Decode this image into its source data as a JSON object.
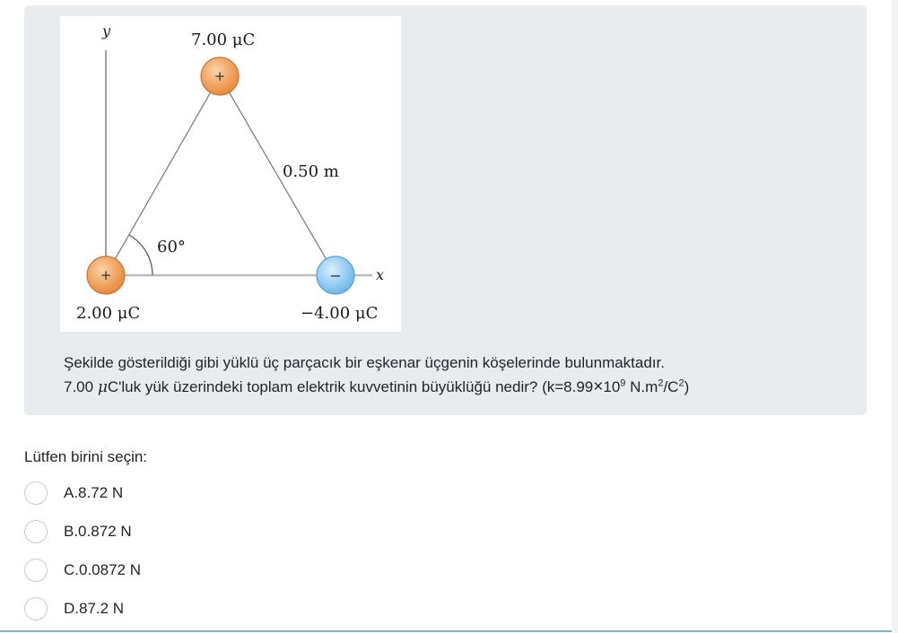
{
  "figure": {
    "axis_y": "y",
    "axis_x": "x",
    "charge_top": "7.00 μC",
    "charge_left": "2.00 μC",
    "charge_right": "−4.00 μC",
    "side_length": "0.50 m",
    "angle": "60°",
    "sign_positive": "+",
    "sign_negative": "−",
    "colors": {
      "positive_charge": "#f0a25a",
      "negative_charge": "#8ec9ef"
    }
  },
  "question": {
    "line1": "Şekilde gösterildiği gibi yüklü üç parçacık bir eşkenar üçgenin köşelerinde bulunmaktadır.",
    "line2_a": "7.00 ",
    "line2_mu": "μ",
    "line2_b": "C'luk yük üzerindeki toplam elektrik kuvvetinin büyüklüğü nedir? (k=8.99",
    "times": "×",
    "line2_c": "10",
    "exp9": "9",
    "line2_d": " N.m",
    "exp2a": "2",
    "line2_e": "/C",
    "exp2b": "2",
    "line2_f": ")"
  },
  "prompt": "Lütfen birini seçin:",
  "options": [
    {
      "label": "A.8.72 N"
    },
    {
      "label": "B.0.872 N"
    },
    {
      "label": "C.0.0872 N"
    },
    {
      "label": "D.87.2 N"
    }
  ]
}
